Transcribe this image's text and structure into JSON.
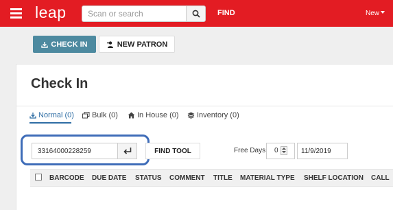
{
  "header": {
    "logo": "leap",
    "search_placeholder": "Scan or search",
    "find_label": "FIND",
    "new_label": "New"
  },
  "actions": {
    "check_in": "CHECK IN",
    "new_patron": "NEW PATRON"
  },
  "page": {
    "title": "Check In"
  },
  "tabs": [
    {
      "label": "Normal (0)",
      "icon": "download-icon",
      "active": true
    },
    {
      "label": "Bulk (0)",
      "icon": "stack-icon",
      "active": false
    },
    {
      "label": "In House (0)",
      "icon": "home-icon",
      "active": false
    },
    {
      "label": "Inventory (0)",
      "icon": "layers-icon",
      "active": false
    }
  ],
  "checkin_form": {
    "barcode_value": "33164000228259",
    "find_tool_label": "FIND TOOL",
    "free_days_label": "Free Days",
    "free_days_value": "0",
    "date_value": "11/9/2019"
  },
  "table": {
    "columns": [
      "BARCODE",
      "DUE DATE",
      "STATUS",
      "COMMENT",
      "TITLE",
      "MATERIAL TYPE",
      "SHELF LOCATION",
      "CALL"
    ]
  },
  "colors": {
    "topbar": "#e31c23",
    "primary_button": "#4d8aa0",
    "active_tab": "#2e6da4",
    "highlight": "#3e6cb8"
  }
}
